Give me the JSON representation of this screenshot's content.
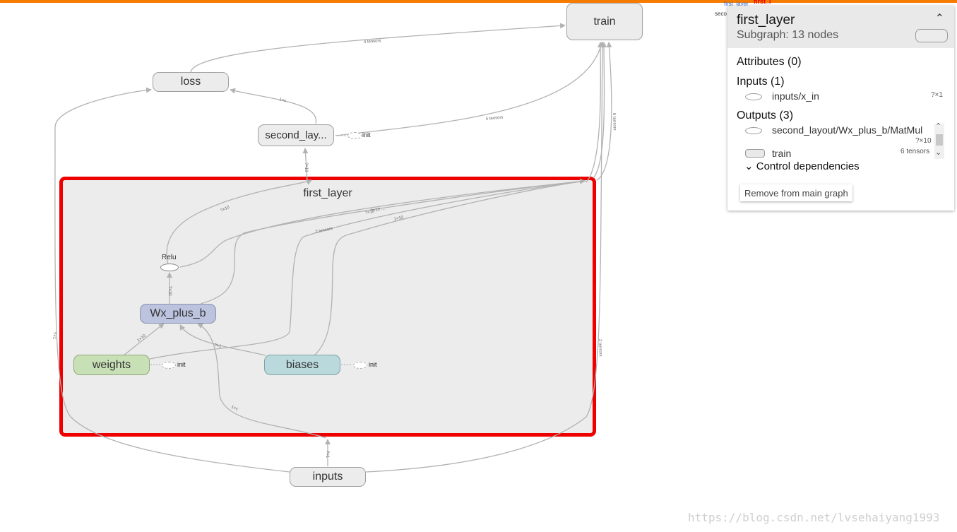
{
  "graph": {
    "nodes": {
      "train": "train",
      "loss": "loss",
      "second_layer": "second_lay...",
      "group_first_layer": "first_layer",
      "relu": "Relu",
      "wx_plus_b": "Wx_plus_b",
      "weights": "weights",
      "biases": "biases",
      "inputs": "inputs"
    },
    "init_labels": {
      "second": "init",
      "weights": "init",
      "biases": "init"
    },
    "edge_labels": {
      "loss_train": "4 tensors",
      "second_loss": "1×c",
      "second_train": "5 tensors",
      "train_right": "6 tensors",
      "group_second": "?×10",
      "relu_second": "?×10",
      "group_train_a": "?×10",
      "group_train_b": "?×10 ...",
      "group_train_c": "2 tensors",
      "biases_train": "1×10",
      "wx_relu": "?×10",
      "weights_wx": "1×10",
      "biases_wx": "?×1",
      "inputs_wx": "1×c",
      "inputs_left": "?×1",
      "inputs_right": "2 tensors",
      "inputs_up": "?×1"
    }
  },
  "minimap": {
    "label1": "first_layer",
    "label2": "first_l",
    "label3": "seco"
  },
  "panel": {
    "title": "first_layer",
    "subtitle": "Subgraph: 13 nodes",
    "attributes_heading": "Attributes (0)",
    "inputs_heading": "Inputs (1)",
    "inputs": [
      {
        "name": "inputs/x_in",
        "shape": "?×1"
      }
    ],
    "outputs_heading": "Outputs (3)",
    "outputs": [
      {
        "name": "second_layout/Wx_plus_b/MatMul",
        "shape": "?×10"
      },
      {
        "name": "train",
        "shape": "6 tensors"
      }
    ],
    "control_dependencies": "Control dependencies",
    "remove_button": "Remove from main graph"
  },
  "watermark": "https://blog.csdn.net/lvsehaiyang1993",
  "colors": {
    "accent_bar": "#f57c00",
    "selection_outline": "#ee0000",
    "node_default": "#ececec",
    "node_wx": "#bcc3de",
    "node_weights": "#c8e0b6",
    "node_biases": "#b9d9dc"
  }
}
